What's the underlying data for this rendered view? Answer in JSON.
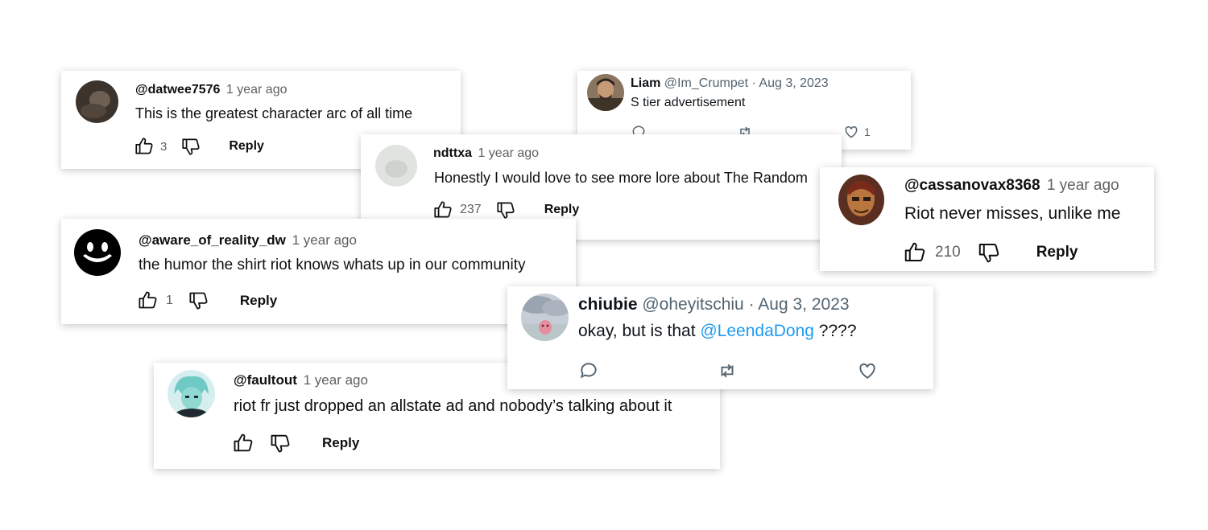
{
  "comments": [
    {
      "handle": "@datwee7576",
      "time": "1 year ago",
      "text": "This is the greatest character arc of all time",
      "likes": "3",
      "reply": "Reply"
    },
    {
      "handle": "@aware_of_reality_dw",
      "time": "1 year ago",
      "text": "the humor the shirt riot knows whats up in our community",
      "likes": "1",
      "reply": "Reply"
    },
    {
      "handle": "@faultout",
      "time": "1 year ago",
      "text": "riot fr just dropped an allstate ad and nobody’s talking about it",
      "likes": "",
      "reply": "Reply"
    },
    {
      "handle": "ndttxa",
      "time": "1 year ago",
      "text": "Honestly I would love to see more lore about The Random",
      "likes": "237",
      "reply": "Reply"
    },
    {
      "handle": "@cassanovax8368",
      "time": "1 year ago",
      "text": "Riot never misses, unlike me",
      "likes": "210",
      "reply": "Reply"
    }
  ],
  "tweets": [
    {
      "name": "Liam",
      "handle": "@Im_Crumpet",
      "sep": "·",
      "date": "Aug 3, 2023",
      "text": "S tier advertisement",
      "likes": "1"
    },
    {
      "name": "chiubie",
      "handle": "@oheyitschiu",
      "sep": "·",
      "date": "Aug 3, 2023",
      "text": "okay, but is that ",
      "mention": "@LeendaDong",
      "text_after": " ????"
    }
  ],
  "icons": [
    "thumbs-up-icon",
    "thumbs-down-icon",
    "reply-bubble-icon",
    "retweet-icon",
    "heart-icon"
  ],
  "colors": {
    "accent_link": "#1d9bf0",
    "muted": "#606060",
    "twitter_muted": "#536471"
  }
}
